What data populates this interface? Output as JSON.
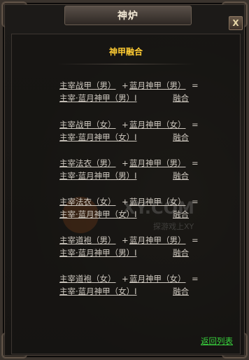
{
  "window": {
    "title": "神炉",
    "close_label": "X"
  },
  "panel": {
    "title": "神甲融合"
  },
  "recipes": [
    {
      "a": "主宰战甲（男）",
      "b": "蓝月神甲（男）",
      "result": "主宰·蓝月神甲（男）I",
      "action": "融合"
    },
    {
      "a": "主宰战甲（女）",
      "b": "蓝月神甲（女）",
      "result": "主宰·蓝月神甲（女）I",
      "action": "融合"
    },
    {
      "a": "主宰法衣（男）",
      "b": "蓝月神甲（男）",
      "result": "主宰·蓝月神甲（男）I",
      "action": "融合"
    },
    {
      "a": "主宰法衣（女）",
      "b": "蓝月神甲（女）",
      "result": "主宰·蓝月神甲（女）I",
      "action": "融合"
    },
    {
      "a": "主宰道袍（男）",
      "b": "蓝月神甲（男）",
      "result": "主宰·蓝月神甲（男）I",
      "action": "融合"
    },
    {
      "a": "主宰道袍（女）",
      "b": "蓝月神甲（女）",
      "result": "主宰·蓝月神甲（女）I",
      "action": "融合"
    }
  ],
  "ops": {
    "plus": "+",
    "equals": "="
  },
  "watermark": {
    "text": "XY.COM",
    "sub": "探游戏上XY"
  },
  "footer": {
    "back_label": "返回列表"
  },
  "colors": {
    "title_accent": "#ffcc33",
    "link": "#cfc9c0",
    "back_link": "#39d23d"
  }
}
